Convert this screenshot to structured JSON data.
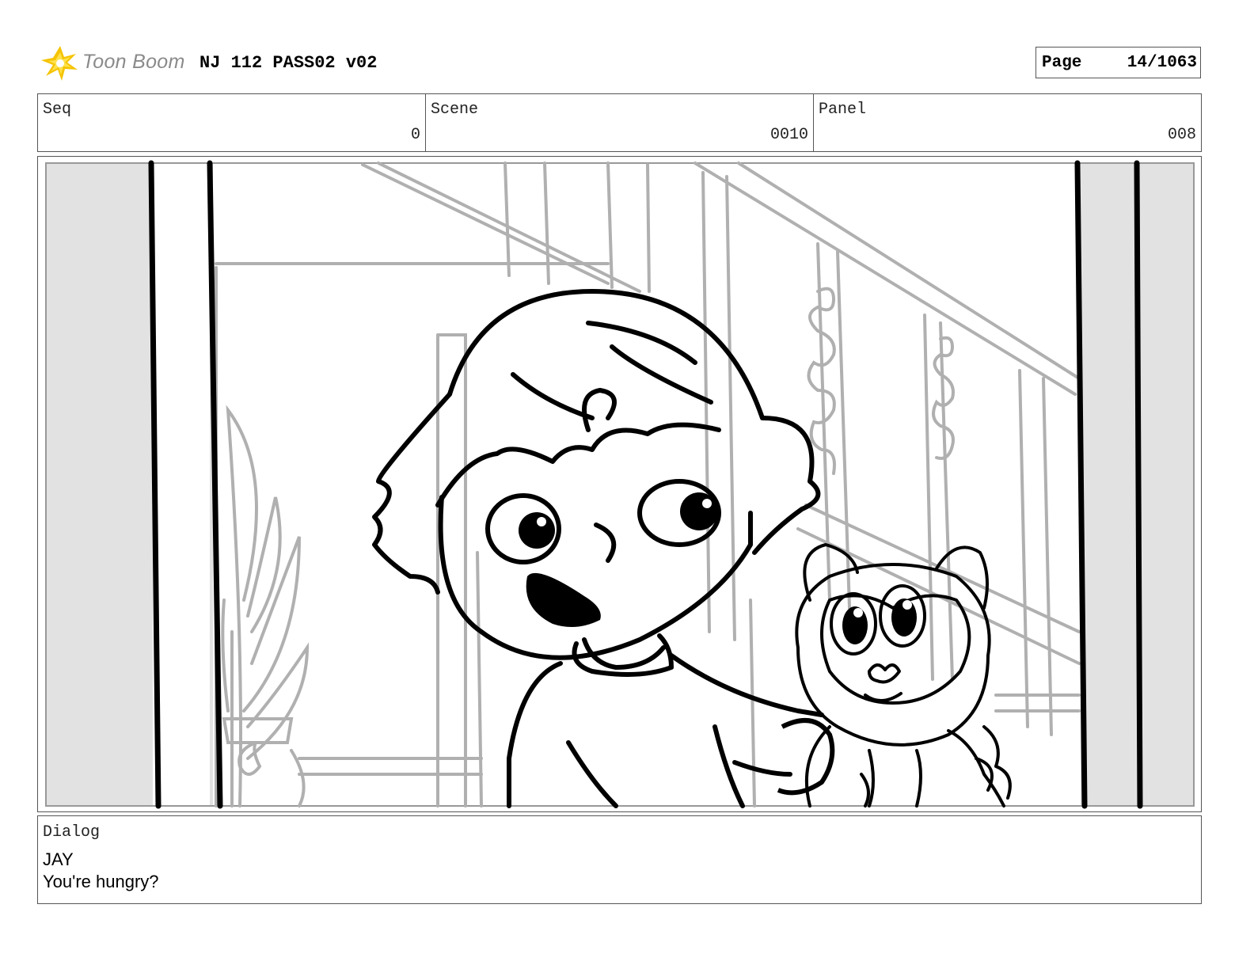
{
  "header": {
    "logo_text": "Toon Boom",
    "project_title": "NJ 112 PASS02 v02",
    "page_label": "Page",
    "page_value": "14/1063"
  },
  "info": {
    "seq_label": "Seq",
    "seq_value": "0",
    "scene_label": "Scene",
    "scene_value": "0010",
    "panel_label": "Panel",
    "panel_value": "008"
  },
  "dialog": {
    "label": "Dialog",
    "speaker": "JAY",
    "line": "You're hungry?"
  },
  "colors": {
    "logo_sun": "#f5c400",
    "logo_text": "#8a8a8a",
    "background_sketch": "#b0b0b0",
    "ink": "#000000",
    "letterbox": "#e2e2e2"
  }
}
